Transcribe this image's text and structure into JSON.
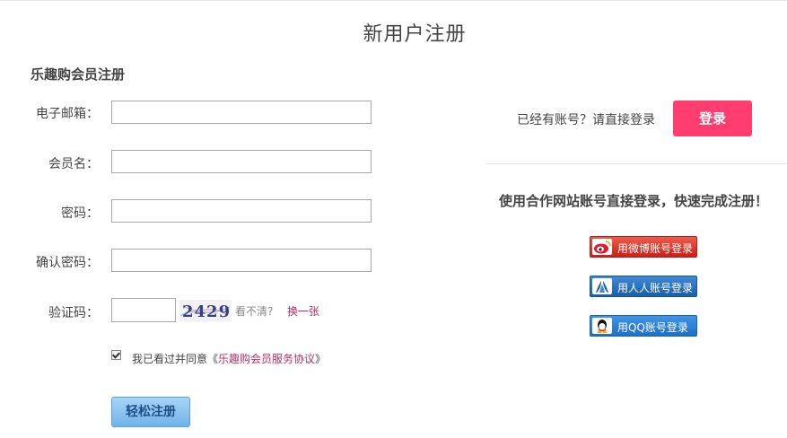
{
  "page_title": "新用户注册",
  "section_title": "乐趣购会员注册",
  "form": {
    "email_label": "电子邮箱：",
    "email_value": "",
    "username_label": "会员名：",
    "username_value": "",
    "password_label": "密码：",
    "password_value": "",
    "confirm_label": "确认密码：",
    "confirm_value": "",
    "captcha_label": "验证码：",
    "captcha_value": "",
    "captcha_code": "2429",
    "captcha_hint": "看不清?",
    "captcha_refresh": "换一张",
    "agree_checked": true,
    "agree_prefix": "我已看过并同意《",
    "agree_link": "乐趣购会员服务协议",
    "agree_suffix": "》",
    "submit_label": "轻松注册"
  },
  "side": {
    "have_account_text": "已经有账号？请直接登录",
    "login_label": "登录",
    "partner_title": "使用合作网站账号直接登录，快速完成注册！",
    "social": [
      {
        "label": "用微博账号登录",
        "icon": "weibo-icon",
        "color": "#d8281d"
      },
      {
        "label": "用人人账号登录",
        "icon": "renren-icon",
        "color": "#2068b8"
      },
      {
        "label": "用QQ账号登录",
        "icon": "qq-icon",
        "color": "#2b7fd6"
      }
    ]
  },
  "colors": {
    "login_button": "#ff3d6e",
    "link": "#b0306a",
    "register_button": "#7ab8ec"
  }
}
